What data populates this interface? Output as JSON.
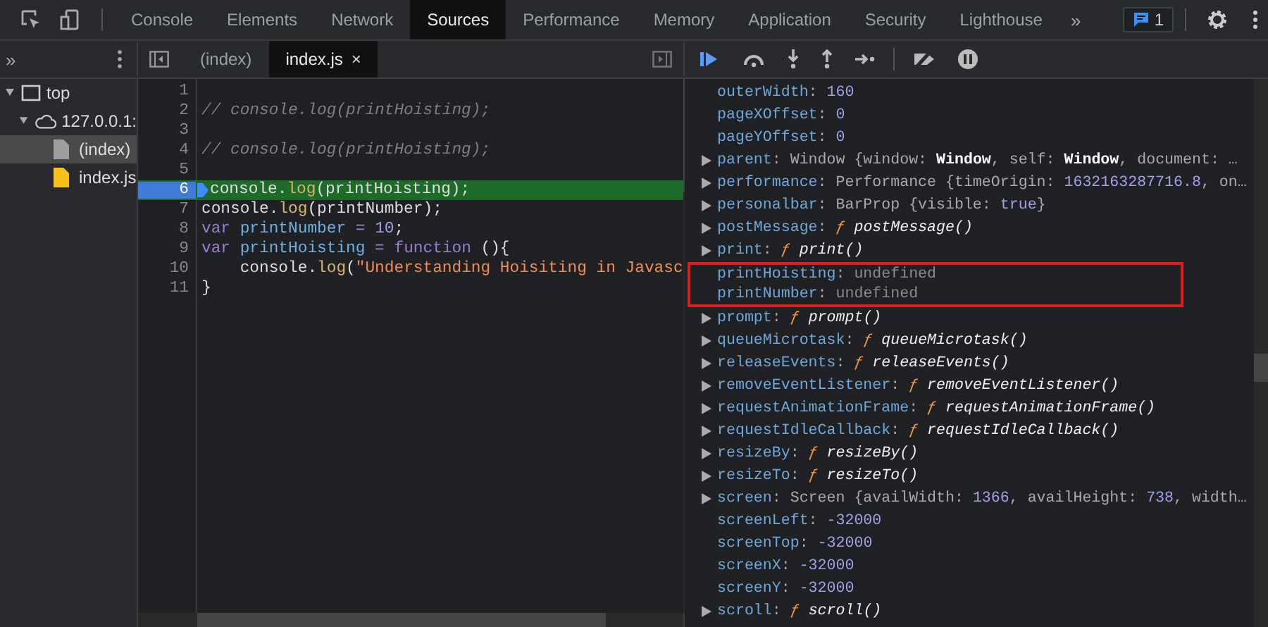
{
  "main_tabs": [
    {
      "label": "Console",
      "selected": false
    },
    {
      "label": "Elements",
      "selected": false
    },
    {
      "label": "Network",
      "selected": false
    },
    {
      "label": "Sources",
      "selected": true
    },
    {
      "label": "Performance",
      "selected": false
    },
    {
      "label": "Memory",
      "selected": false
    },
    {
      "label": "Application",
      "selected": false
    },
    {
      "label": "Security",
      "selected": false
    },
    {
      "label": "Lighthouse",
      "selected": false
    }
  ],
  "more_tabs": "»",
  "issues_badge": "1",
  "navigator": {
    "more": "»",
    "tree": [
      {
        "label": "top",
        "kind": "frame",
        "expanded": true,
        "children": [
          {
            "label": "127.0.0.1:",
            "kind": "origin",
            "expanded": true,
            "children": [
              {
                "label": "(index)",
                "kind": "file",
                "selected": true
              },
              {
                "label": "index.js",
                "kind": "script",
                "selected": false
              }
            ]
          }
        ]
      }
    ]
  },
  "editor_tabs": [
    {
      "label": "(index)",
      "selected": false
    },
    {
      "label": "index.js",
      "selected": true,
      "close": "×"
    }
  ],
  "code_lines": [
    {
      "num": "1",
      "paused": false
    },
    {
      "num": "2",
      "paused": false,
      "tokens": [
        {
          "kind": "comment",
          "text": "// console.log(printHoisting);"
        }
      ]
    },
    {
      "num": "3",
      "paused": false
    },
    {
      "num": "4",
      "paused": false,
      "tokens": [
        {
          "kind": "comment",
          "text": "// console.log(printHoisting);"
        }
      ]
    },
    {
      "num": "5",
      "paused": false
    },
    {
      "num": "6",
      "paused": true,
      "tokens": [
        {
          "kind": "plain",
          "text": "console."
        },
        {
          "kind": "call",
          "text": "log"
        },
        {
          "kind": "plain",
          "text": "(printHoisting);"
        }
      ]
    },
    {
      "num": "7",
      "paused": false,
      "tokens": [
        {
          "kind": "plain",
          "text": "console."
        },
        {
          "kind": "call",
          "text": "log"
        },
        {
          "kind": "plain",
          "text": "(printNumber);"
        }
      ]
    },
    {
      "num": "8",
      "paused": false,
      "tokens": [
        {
          "kind": "keyword",
          "text": "var "
        },
        {
          "kind": "name",
          "text": "printNumber"
        },
        {
          "kind": "op",
          "text": " = "
        },
        {
          "kind": "number",
          "text": "10"
        },
        {
          "kind": "plain",
          "text": ";"
        }
      ]
    },
    {
      "num": "9",
      "paused": false,
      "tokens": [
        {
          "kind": "keyword",
          "text": "var "
        },
        {
          "kind": "name",
          "text": "printHoisting"
        },
        {
          "kind": "op",
          "text": " = "
        },
        {
          "kind": "keyword",
          "text": "function"
        },
        {
          "kind": "plain",
          "text": " (){"
        }
      ]
    },
    {
      "num": "10",
      "paused": false,
      "tokens": [
        {
          "kind": "plain",
          "text": "    console."
        },
        {
          "kind": "call",
          "text": "log"
        },
        {
          "kind": "plain",
          "text": "("
        },
        {
          "kind": "string",
          "text": "\"Understanding Hoisiting in Javasc"
        }
      ]
    },
    {
      "num": "11",
      "paused": false,
      "tokens": [
        {
          "kind": "plain",
          "text": "}"
        }
      ]
    }
  ],
  "scope": [
    {
      "name": "outerWidth",
      "expandable": false,
      "highlighted": false,
      "value": [
        {
          "kind": "plain",
          "text": ": "
        },
        {
          "kind": "number",
          "text": "160"
        }
      ]
    },
    {
      "name": "pageXOffset",
      "expandable": false,
      "highlighted": false,
      "value": [
        {
          "kind": "plain",
          "text": ": "
        },
        {
          "kind": "number",
          "text": "0"
        }
      ]
    },
    {
      "name": "pageYOffset",
      "expandable": false,
      "highlighted": false,
      "value": [
        {
          "kind": "plain",
          "text": ": "
        },
        {
          "kind": "number",
          "text": "0"
        }
      ]
    },
    {
      "name": "parent",
      "expandable": true,
      "highlighted": false,
      "value": [
        {
          "kind": "plain",
          "text": ": Window {window: "
        },
        {
          "kind": "bold",
          "text": "Window"
        },
        {
          "kind": "plain",
          "text": ", self: "
        },
        {
          "kind": "bold",
          "text": "Window"
        },
        {
          "kind": "plain",
          "text": ", document: …"
        }
      ]
    },
    {
      "name": "performance",
      "expandable": true,
      "highlighted": false,
      "value": [
        {
          "kind": "plain",
          "text": ": Performance {timeOrigin: "
        },
        {
          "kind": "number",
          "text": "1632163287716.8"
        },
        {
          "kind": "plain",
          "text": ", on…"
        }
      ]
    },
    {
      "name": "personalbar",
      "expandable": true,
      "highlighted": false,
      "value": [
        {
          "kind": "plain",
          "text": ": BarProp {visible: "
        },
        {
          "kind": "number",
          "text": "true"
        },
        {
          "kind": "plain",
          "text": "}"
        }
      ]
    },
    {
      "name": "postMessage",
      "expandable": true,
      "highlighted": false,
      "value": [
        {
          "kind": "plain",
          "text": ": "
        },
        {
          "kind": "f",
          "text": "ƒ "
        },
        {
          "kind": "fname",
          "text": "postMessage()"
        }
      ]
    },
    {
      "name": "print",
      "expandable": true,
      "highlighted": false,
      "value": [
        {
          "kind": "plain",
          "text": ": "
        },
        {
          "kind": "f",
          "text": "ƒ "
        },
        {
          "kind": "fname",
          "text": "print()"
        }
      ]
    },
    {
      "name": "printHoisting",
      "expandable": false,
      "highlighted": true,
      "value": [
        {
          "kind": "plain",
          "text": ": "
        },
        {
          "kind": "undef",
          "text": "undefined"
        }
      ]
    },
    {
      "name": "printNumber",
      "expandable": false,
      "highlighted": true,
      "value": [
        {
          "kind": "plain",
          "text": ": "
        },
        {
          "kind": "undef",
          "text": "undefined"
        }
      ]
    },
    {
      "name": "prompt",
      "expandable": true,
      "highlighted": false,
      "value": [
        {
          "kind": "plain",
          "text": ": "
        },
        {
          "kind": "f",
          "text": "ƒ "
        },
        {
          "kind": "fname",
          "text": "prompt()"
        }
      ]
    },
    {
      "name": "queueMicrotask",
      "expandable": true,
      "highlighted": false,
      "value": [
        {
          "kind": "plain",
          "text": ": "
        },
        {
          "kind": "f",
          "text": "ƒ "
        },
        {
          "kind": "fname",
          "text": "queueMicrotask()"
        }
      ]
    },
    {
      "name": "releaseEvents",
      "expandable": true,
      "highlighted": false,
      "value": [
        {
          "kind": "plain",
          "text": ": "
        },
        {
          "kind": "f",
          "text": "ƒ "
        },
        {
          "kind": "fname",
          "text": "releaseEvents()"
        }
      ]
    },
    {
      "name": "removeEventListener",
      "expandable": true,
      "highlighted": false,
      "value": [
        {
          "kind": "plain",
          "text": ": "
        },
        {
          "kind": "f",
          "text": "ƒ "
        },
        {
          "kind": "fname",
          "text": "removeEventListener()"
        }
      ]
    },
    {
      "name": "requestAnimationFrame",
      "expandable": true,
      "highlighted": false,
      "value": [
        {
          "kind": "plain",
          "text": ": "
        },
        {
          "kind": "f",
          "text": "ƒ "
        },
        {
          "kind": "fname",
          "text": "requestAnimationFrame()"
        }
      ]
    },
    {
      "name": "requestIdleCallback",
      "expandable": true,
      "highlighted": false,
      "value": [
        {
          "kind": "plain",
          "text": ": "
        },
        {
          "kind": "f",
          "text": "ƒ "
        },
        {
          "kind": "fname",
          "text": "requestIdleCallback()"
        }
      ]
    },
    {
      "name": "resizeBy",
      "expandable": true,
      "highlighted": false,
      "value": [
        {
          "kind": "plain",
          "text": ": "
        },
        {
          "kind": "f",
          "text": "ƒ "
        },
        {
          "kind": "fname",
          "text": "resizeBy()"
        }
      ]
    },
    {
      "name": "resizeTo",
      "expandable": true,
      "highlighted": false,
      "value": [
        {
          "kind": "plain",
          "text": ": "
        },
        {
          "kind": "f",
          "text": "ƒ "
        },
        {
          "kind": "fname",
          "text": "resizeTo()"
        }
      ]
    },
    {
      "name": "screen",
      "expandable": true,
      "highlighted": false,
      "value": [
        {
          "kind": "plain",
          "text": ": Screen {availWidth: "
        },
        {
          "kind": "number",
          "text": "1366"
        },
        {
          "kind": "plain",
          "text": ", availHeight: "
        },
        {
          "kind": "number",
          "text": "738"
        },
        {
          "kind": "plain",
          "text": ", width…"
        }
      ]
    },
    {
      "name": "screenLeft",
      "expandable": false,
      "highlighted": false,
      "value": [
        {
          "kind": "plain",
          "text": ": "
        },
        {
          "kind": "number",
          "text": "-32000"
        }
      ]
    },
    {
      "name": "screenTop",
      "expandable": false,
      "highlighted": false,
      "value": [
        {
          "kind": "plain",
          "text": ": "
        },
        {
          "kind": "number",
          "text": "-32000"
        }
      ]
    },
    {
      "name": "screenX",
      "expandable": false,
      "highlighted": false,
      "value": [
        {
          "kind": "plain",
          "text": ": "
        },
        {
          "kind": "number",
          "text": "-32000"
        }
      ]
    },
    {
      "name": "screenY",
      "expandable": false,
      "highlighted": false,
      "value": [
        {
          "kind": "plain",
          "text": ": "
        },
        {
          "kind": "number",
          "text": "-32000"
        }
      ]
    },
    {
      "name": "scroll",
      "expandable": true,
      "highlighted": false,
      "value": [
        {
          "kind": "plain",
          "text": ": "
        },
        {
          "kind": "f",
          "text": "ƒ "
        },
        {
          "kind": "fname",
          "text": "scroll()"
        }
      ]
    }
  ]
}
